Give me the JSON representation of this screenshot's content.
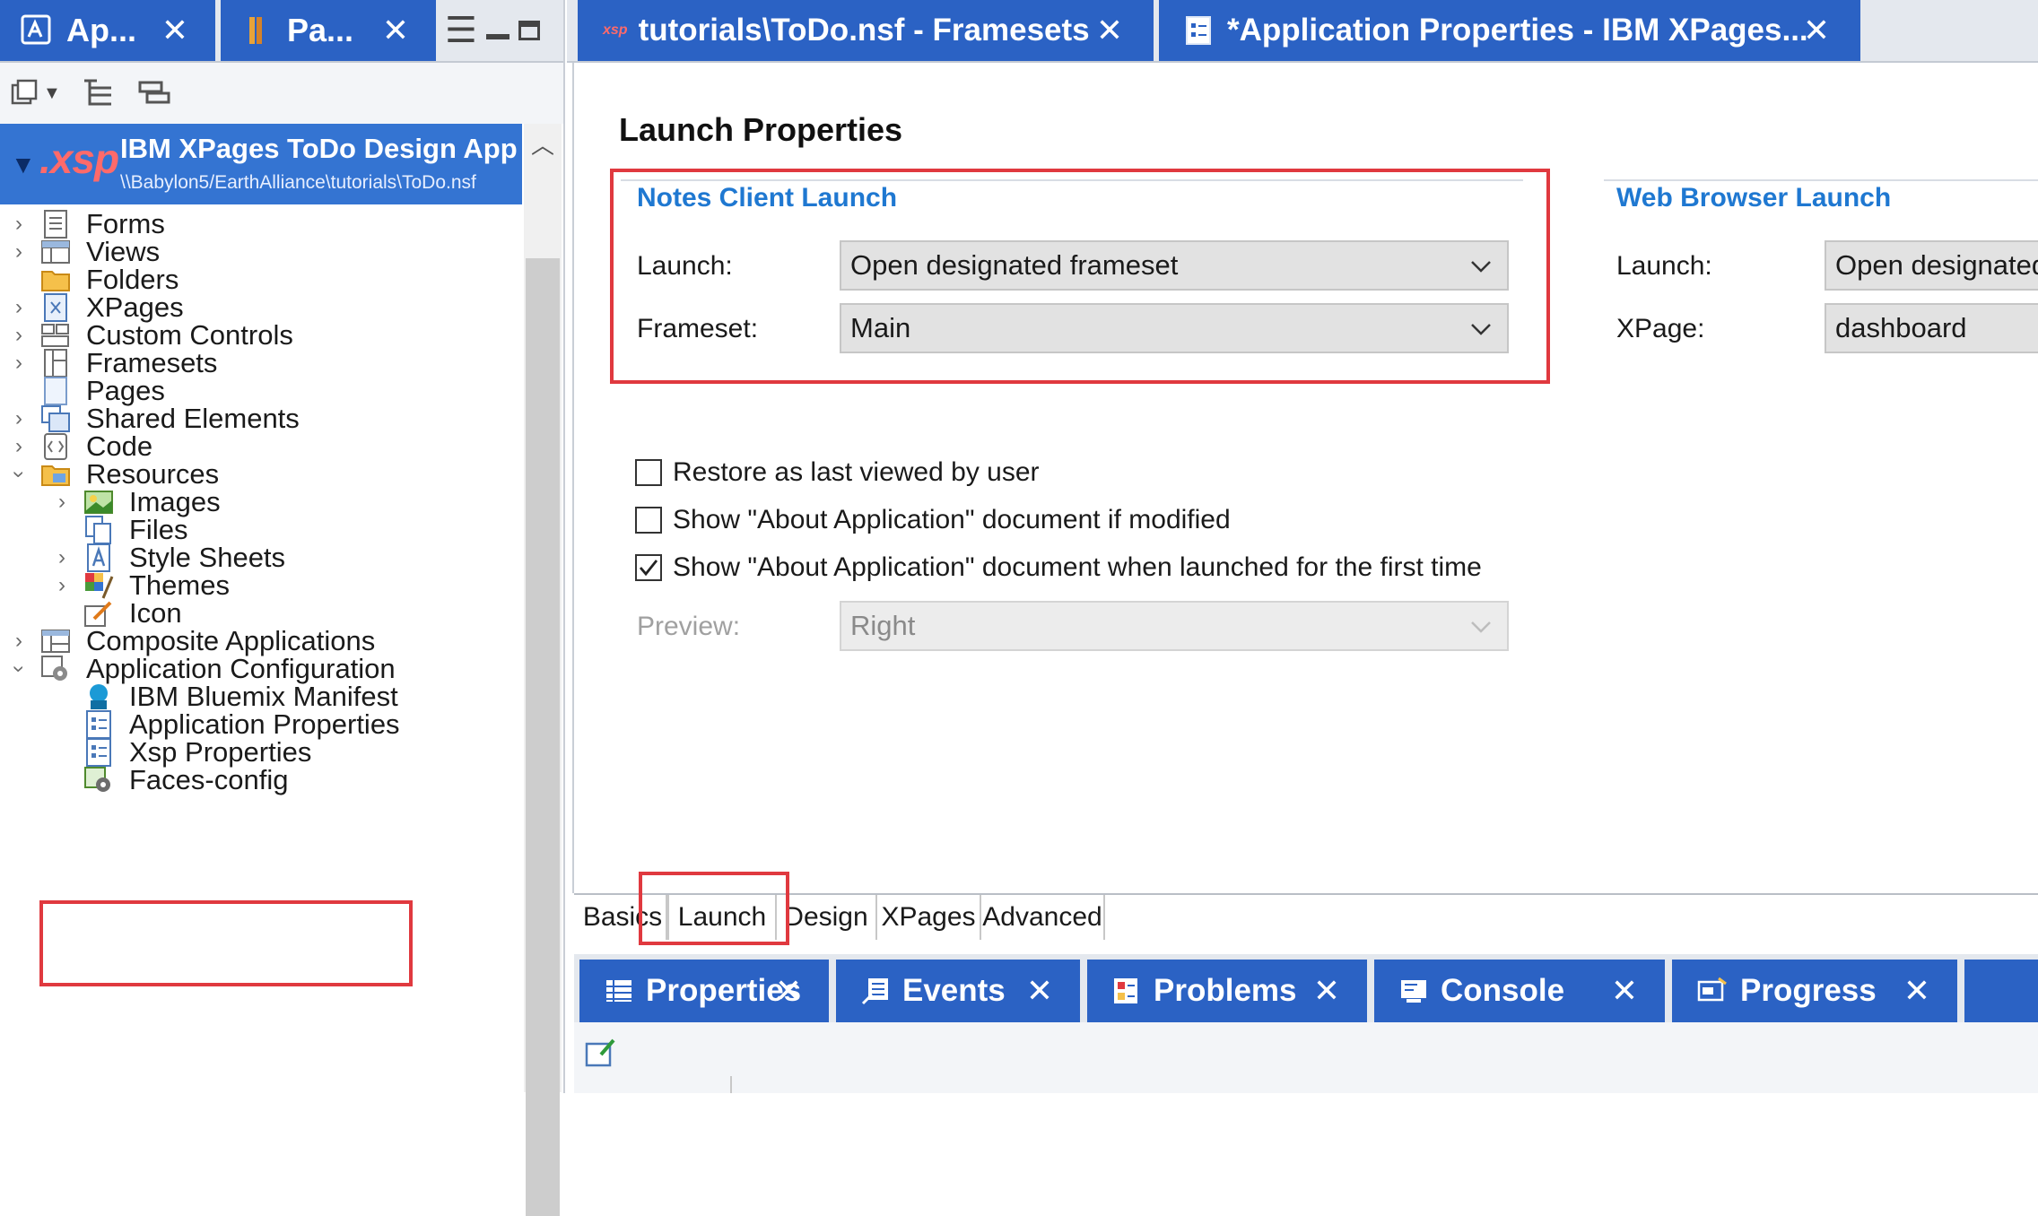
{
  "left_tabs": [
    {
      "label": "Ap...",
      "icon": "application-navigator-icon"
    },
    {
      "label": "Pa...",
      "icon": "package-explorer-icon"
    }
  ],
  "project": {
    "xsp_badge": ".xsp",
    "name": "IBM XPages ToDo Design App",
    "path": "\\\\Babylon5/EarthAlliance\\tutorials\\ToDo.nsf"
  },
  "tree": {
    "forms": "Forms",
    "views": "Views",
    "folders": "Folders",
    "xpages": "XPages",
    "custom_controls": "Custom Controls",
    "framesets": "Framesets",
    "pages": "Pages",
    "shared_elements": "Shared Elements",
    "code": "Code",
    "resources": "Resources",
    "images": "Images",
    "files": "Files",
    "style_sheets": "Style Sheets",
    "themes": "Themes",
    "icon": "Icon",
    "composite_applications": "Composite Applications",
    "application_configuration": "Application Configuration",
    "bluemix_manifest": "IBM Bluemix Manifest",
    "application_properties": "Application Properties",
    "xsp_properties": "Xsp Properties",
    "faces_config": "Faces-config"
  },
  "editor_tabs_top": [
    {
      "label": "tutorials\\ToDo.nsf - Framesets",
      "badge": "xsp"
    },
    {
      "label": "*Application Properties - IBM XPages..."
    }
  ],
  "launch": {
    "title": "Launch Properties",
    "notes_group": "Notes Client Launch",
    "launch_label": "Launch:",
    "launch_value": "Open designated frameset",
    "frameset_label": "Frameset:",
    "frameset_value": "Main",
    "web_group": "Web Browser Launch",
    "web_launch_label": "Launch:",
    "web_launch_value": "Open designated",
    "xpage_label": "XPage:",
    "xpage_value": "dashboard",
    "restore_label": "Restore as last viewed by user",
    "restore_checked": false,
    "show_modified_label": "Show \"About Application\" document if modified",
    "show_modified_checked": false,
    "show_first_label": "Show \"About Application\" document when launched for the first time",
    "show_first_checked": true,
    "preview_label": "Preview:",
    "preview_value": "Right"
  },
  "editor_tabs_bottom": [
    "Basics",
    "Launch",
    "Design",
    "XPages",
    "Advanced"
  ],
  "bottom_tabs": [
    "Properties",
    "Events",
    "Problems",
    "Console",
    "Progress"
  ],
  "colors": {
    "accent": "#2b62c4",
    "highlight_box": "#e0393f",
    "group_title": "#1f78d1"
  }
}
